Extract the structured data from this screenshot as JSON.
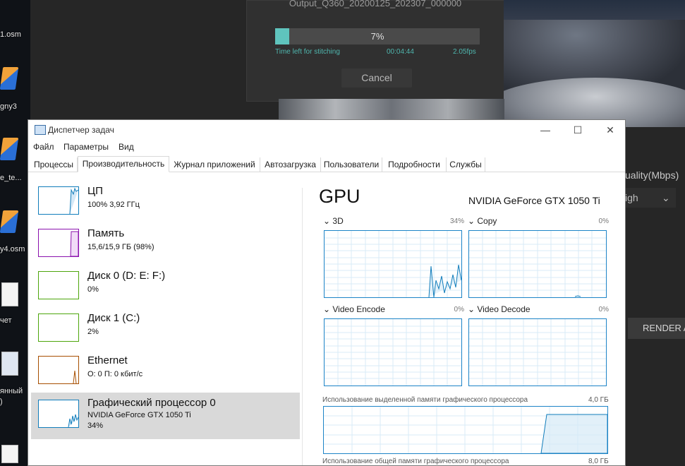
{
  "desktop": {
    "labels": [
      "1.osm",
      "gny3",
      "e_te...",
      "y4.osm",
      "чет",
      "янный",
      ")"
    ]
  },
  "stitch_dialog": {
    "filename": "Output_Q360_20200125_202307_000000",
    "progress_fraction": 0.07,
    "progress_text": "7%",
    "time_left_label": "Time left for stitching",
    "time_left": "00:04:44",
    "fps": "2.05fps",
    "cancel_label": "Cancel"
  },
  "app_right": {
    "quality_label": "uality(Mbps)",
    "quality_value": "igh",
    "render_label": "RENDER A"
  },
  "task_manager": {
    "title": "Диспетчер задач",
    "window_buttons": {
      "minimize": "—",
      "maximize": "☐",
      "close": "✕"
    },
    "menu": [
      "Файл",
      "Параметры",
      "Вид"
    ],
    "tabs": [
      "Процессы",
      "Производительность",
      "Журнал приложений",
      "Автозагрузка",
      "Пользователи",
      "Подробности",
      "Службы"
    ],
    "active_tab": "Производительность",
    "resources": [
      {
        "name": "ЦП",
        "sub1": "100% 3,92 ГГц",
        "sub2": "",
        "color": "#117dbb"
      },
      {
        "name": "Память",
        "sub1": "15,6/15,9 ГБ (98%)",
        "sub2": "",
        "color": "#8b12ae"
      },
      {
        "name": "Диск 0 (D: E: F:)",
        "sub1": "0%",
        "sub2": "",
        "color": "#4da60c"
      },
      {
        "name": "Диск 1 (C:)",
        "sub1": "2%",
        "sub2": "",
        "color": "#4da60c"
      },
      {
        "name": "Ethernet",
        "sub1": "О: 0 П: 0 кбит/с",
        "sub2": "",
        "color": "#a74f01"
      },
      {
        "name": "Графический процессор 0",
        "sub1": "NVIDIA GeForce GTX 1050 Ti",
        "sub2": "34%",
        "color": "#117dbb"
      }
    ],
    "gpu": {
      "title": "GPU",
      "model": "NVIDIA GeForce GTX 1050 Ti",
      "engines": [
        {
          "name": "3D",
          "pct": "34%"
        },
        {
          "name": "Copy",
          "pct": "0%"
        },
        {
          "name": "Video Encode",
          "pct": "0%"
        },
        {
          "name": "Video Decode",
          "pct": "0%"
        }
      ],
      "dedicated_label": "Использование выделенной памяти графического процессора",
      "dedicated_max": "4,0 ГБ",
      "shared_label": "Использование общей памяти графического процессора",
      "shared_max": "8,0 ГБ"
    }
  }
}
